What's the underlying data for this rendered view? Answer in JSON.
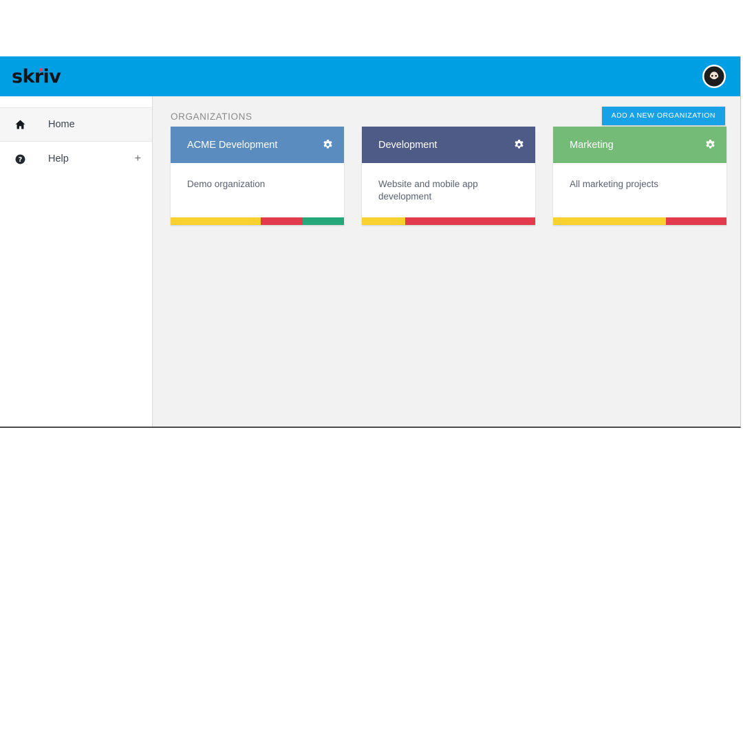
{
  "app": {
    "brand_name": "skriv",
    "brand_dot_color": "#e8405c",
    "topbar_color": "#009fe3",
    "avatar_icon": "bearded-user-avatar-icon"
  },
  "sidebar": {
    "items": [
      {
        "label": "Home",
        "icon": "home-icon",
        "active": true,
        "expander": ""
      },
      {
        "label": "Help",
        "icon": "help-circle-icon",
        "active": false,
        "expander": "+"
      }
    ]
  },
  "main": {
    "section_title": "ORGANIZATIONS",
    "add_button_label": "ADD A NEW ORGANIZATION",
    "add_button_color": "#17a2e8",
    "organizations": [
      {
        "name": "ACME Development",
        "description": "Demo organization",
        "header_color": "#5b8cc0",
        "gear_icon": "gear-icon",
        "bar": [
          {
            "color": "#fad02e",
            "percent": 52
          },
          {
            "color": "#e23b4b",
            "percent": 24
          },
          {
            "color": "#25a779",
            "percent": 24
          }
        ]
      },
      {
        "name": "Development",
        "description": "Website and mobile app development",
        "header_color": "#4f5b87",
        "gear_icon": "gear-icon",
        "bar": [
          {
            "color": "#fad02e",
            "percent": 25
          },
          {
            "color": "#e23b4b",
            "percent": 75
          }
        ]
      },
      {
        "name": "Marketing",
        "description": "All marketing projects",
        "header_color": "#73bb77",
        "gear_icon": "gear-icon",
        "bar": [
          {
            "color": "#fad02e",
            "percent": 65
          },
          {
            "color": "#e23b4b",
            "percent": 35
          }
        ]
      }
    ]
  }
}
